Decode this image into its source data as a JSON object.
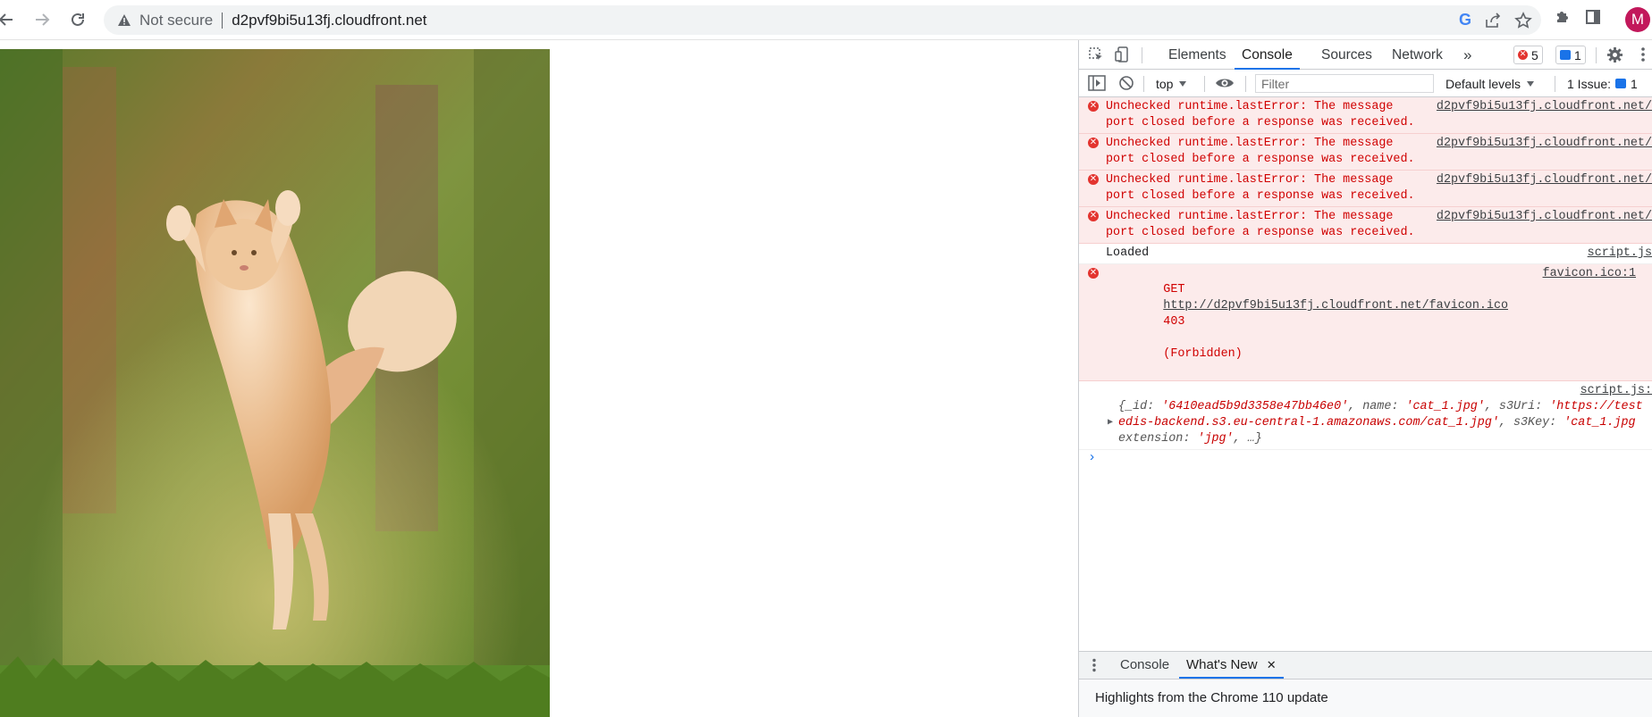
{
  "browser": {
    "security_label": "Not secure",
    "url": "d2pvf9bi5u13fj.cloudfront.net",
    "avatar_letter": "M"
  },
  "page": {
    "image_alt": "cat"
  },
  "devtools": {
    "tabs": [
      "Elements",
      "Console",
      "Sources",
      "Network"
    ],
    "more_tabs": "»",
    "error_count": "5",
    "message_count": "1",
    "toolbar": {
      "context": "top",
      "filter_placeholder": "Filter",
      "levels": "Default levels",
      "issues_label": "1 Issue:",
      "issues_count": "1"
    },
    "messages": [
      {
        "type": "error",
        "text": "Unchecked runtime.lastError: The message\nport closed before a response was received.",
        "source": "d2pvf9bi5u13fj.cloudfront.net/"
      },
      {
        "type": "error",
        "text": "Unchecked runtime.lastError: The message\nport closed before a response was received.",
        "source": "d2pvf9bi5u13fj.cloudfront.net/"
      },
      {
        "type": "error",
        "text": "Unchecked runtime.lastError: The message\nport closed before a response was received.",
        "source": "d2pvf9bi5u13fj.cloudfront.net/"
      },
      {
        "type": "error",
        "text": "Unchecked runtime.lastError: The message\nport closed before a response was received.",
        "source": "d2pvf9bi5u13fj.cloudfront.net/"
      }
    ],
    "log_loaded": {
      "text": "Loaded",
      "source": "script.js"
    },
    "get_error": {
      "method": "GET",
      "url": "http://d2pvf9bi5u13fj.cloudfront.net/favicon.ico",
      "status": "403",
      "status_text": "(Forbidden)",
      "source": "favicon.ico:1"
    },
    "object_log": {
      "source": "script.js:",
      "line1_prefix": "{_id: ",
      "id_value": "'6410ead5b9d3358e47bb46e0'",
      "name_key": ", name: ",
      "name_value": "'cat_1.jpg'",
      "s3uri_key": ", s3Uri: ",
      "s3uri_value_a": "'https://test",
      "s3uri_value_b": "edis-backend.s3.eu-central-1.amazonaws.com/cat_1.jpg'",
      "s3key_key": ", s3Key: ",
      "s3key_value": "'cat_1.jpg",
      "ext_key": "extension: ",
      "ext_value": "'jpg'",
      "ext_tail": ", …}"
    },
    "prompt_symbol": "›",
    "drawer": {
      "tabs": [
        "Console",
        "What's New"
      ],
      "close_symbol": "✕",
      "highlights": "Highlights from the Chrome 110 update"
    }
  }
}
